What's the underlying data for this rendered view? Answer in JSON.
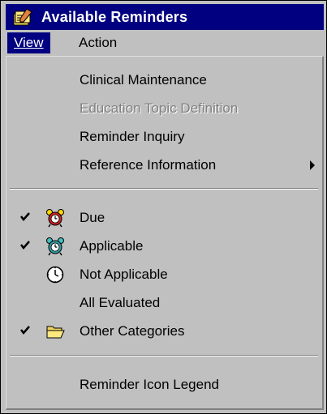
{
  "title": "Available Reminders",
  "menubar": {
    "view_label": "View",
    "action_label": "Action"
  },
  "menu": {
    "items": [
      {
        "label": "Clinical Maintenance",
        "enabled": true
      },
      {
        "label": "Education Topic Definition",
        "enabled": false
      },
      {
        "label": "Reminder Inquiry",
        "enabled": true
      },
      {
        "label": "Reference Information",
        "enabled": true,
        "submenu": true
      },
      {
        "label": "Due",
        "checked": true,
        "icon": "alarm-clock-red-icon"
      },
      {
        "label": "Applicable",
        "checked": true,
        "icon": "alarm-clock-blue-icon"
      },
      {
        "label": "Not Applicable",
        "checked": false,
        "icon": "clock-icon"
      },
      {
        "label": "All Evaluated",
        "checked": false
      },
      {
        "label": "Other Categories",
        "checked": true,
        "icon": "folder-open-icon"
      },
      {
        "label": "Reminder Icon Legend",
        "enabled": true
      }
    ]
  },
  "colors": {
    "titlebar": "#000080",
    "menu_bg": "#c0c0c0",
    "disabled_text": "#808080"
  }
}
